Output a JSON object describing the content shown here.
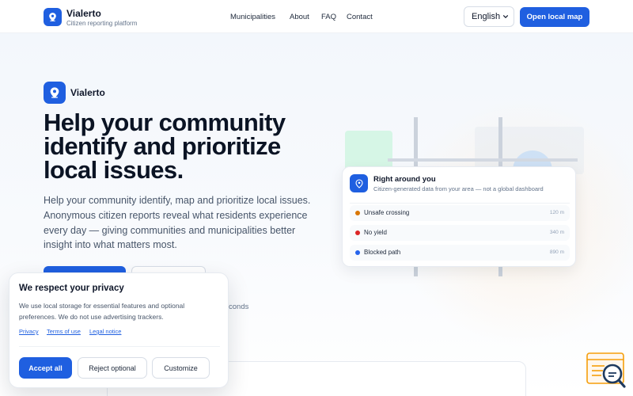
{
  "header": {
    "brand_name": "Vialerto",
    "brand_tagline": "Citizen reporting platform",
    "nav": [
      {
        "label": "Municipalities"
      },
      {
        "label": "About"
      },
      {
        "label": "FAQ"
      },
      {
        "label": "Contact"
      }
    ],
    "language": "English",
    "cta_label": "Open local map"
  },
  "hero": {
    "brand_name": "Vialerto",
    "title": "Help your community identify and prioritize local issues.",
    "description": "Help your community identify, map and prioritize local issues. Anonymous citizen reports reveal what residents experience every day — giving communities and municipalities better insight into what matters most.",
    "note_fragment": "conds"
  },
  "info_card": {
    "title": "Right around you",
    "subtitle": "Citizen-generated data from your area — not a global dashboard",
    "issues": [
      {
        "label": "Unsafe crossing",
        "distance": "120 m",
        "color": "#d97706"
      },
      {
        "label": "No yield",
        "distance": "340 m",
        "color": "#dc2626"
      },
      {
        "label": "Blocked path",
        "distance": "890 m",
        "color": "#2563eb"
      }
    ]
  },
  "cookie_banner": {
    "title": "We respect your privacy",
    "text": "We use local storage for essential features and optional preferences. We do not use advertising trackers.",
    "links": [
      {
        "label": "Privacy"
      },
      {
        "label": "Terms of use"
      },
      {
        "label": "Legal notice"
      }
    ],
    "accept_label": "Accept all",
    "reject_label": "Reject optional",
    "customize_label": "Customize"
  },
  "icons": {
    "brand": "map-pin-icon",
    "feedback_widget": "chat-search-icon"
  },
  "colors": {
    "accent": "#1f5fe0",
    "text": "#0f172a",
    "muted": "#64748b"
  }
}
